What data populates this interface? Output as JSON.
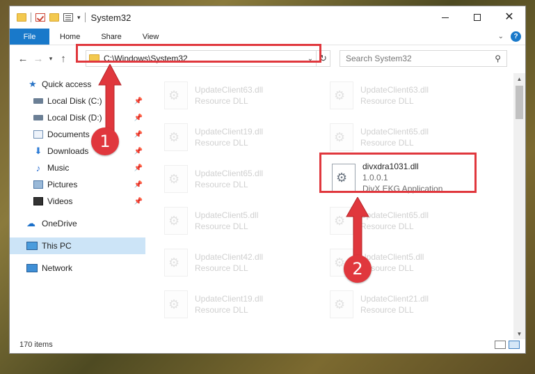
{
  "window": {
    "title": "System32",
    "controls": {
      "minimize_icon": "minimize-icon",
      "maximize_icon": "maximize-icon",
      "close_icon": "close-icon"
    }
  },
  "ribbon": {
    "tabs": [
      "File",
      "Home",
      "Share",
      "View"
    ],
    "help_label": "?"
  },
  "address": {
    "path": "C:\\Windows\\System32",
    "search_placeholder": "Search System32"
  },
  "navpane": {
    "quick_access": "Quick access",
    "items": [
      {
        "label": "Local Disk (C:)",
        "icon": "drive-icon",
        "pinned": true
      },
      {
        "label": "Local Disk (D:)",
        "icon": "drive-icon",
        "pinned": true
      },
      {
        "label": "Documents",
        "icon": "documents-icon",
        "pinned": true
      },
      {
        "label": "Downloads",
        "icon": "download-icon",
        "pinned": true
      },
      {
        "label": "Music",
        "icon": "music-icon",
        "pinned": true
      },
      {
        "label": "Pictures",
        "icon": "pictures-icon",
        "pinned": true
      },
      {
        "label": "Videos",
        "icon": "videos-icon",
        "pinned": true
      }
    ],
    "onedrive": "OneDrive",
    "this_pc": "This PC",
    "network": "Network"
  },
  "files": [
    {
      "name": "UpdateClient63.dll",
      "type": "Resource DLL",
      "faded": true
    },
    {
      "name": "UpdateClient63.dll",
      "type": "Resource DLL",
      "faded": true
    },
    {
      "name": "UpdateClient19.dll",
      "type": "Resource DLL",
      "faded": true
    },
    {
      "name": "UpdateClient65.dll",
      "type": "Resource DLL",
      "faded": true
    },
    {
      "name": "UpdateClient65.dll",
      "type": "Resource DLL",
      "faded": true
    },
    {
      "name": "divxdra1031.dll",
      "version": "1.0.0.1",
      "type": "DivX EKG Application",
      "faded": false
    },
    {
      "name": "UpdateClient5.dll",
      "type": "Resource DLL",
      "faded": true
    },
    {
      "name": "UpdateClient65.dll",
      "type": "Resource DLL",
      "faded": true
    },
    {
      "name": "UpdateClient42.dll",
      "type": "Resource DLL",
      "faded": true
    },
    {
      "name": "UpdateClient5.dll",
      "type": "Resource DLL",
      "faded": true
    },
    {
      "name": "UpdateClient19.dll",
      "type": "Resource DLL",
      "faded": true
    },
    {
      "name": "UpdateClient21.dll",
      "type": "Resource DLL",
      "faded": true
    }
  ],
  "status": {
    "items_count": "170 items"
  },
  "annotations": {
    "badge1": "1",
    "badge2": "2",
    "accent_color": "#e0373d"
  },
  "colors": {
    "ribbon_file_tab": "#1979ca",
    "selection": "#cce4f7"
  }
}
